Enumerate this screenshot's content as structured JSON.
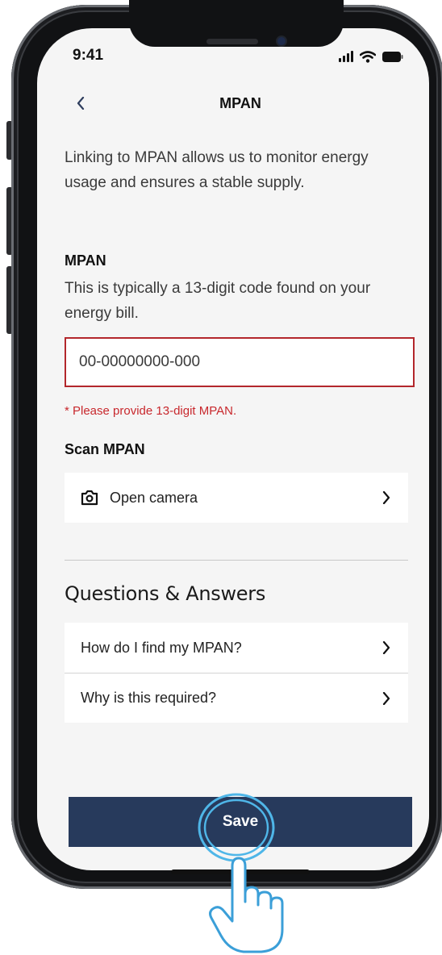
{
  "status_bar": {
    "time": "9:41"
  },
  "header": {
    "title": "MPAN"
  },
  "intro_text": "Linking to MPAN allows us to monitor energy usage and ensures a stable supply.",
  "mpan_field": {
    "label": "MPAN",
    "hint": "This is typically a 13-digit code found on your energy bill.",
    "placeholder": "00-00000000-000",
    "value": "",
    "error": "* Please provide 13-digit MPAN."
  },
  "scan_section": {
    "label": "Scan MPAN",
    "open_camera_label": "Open camera",
    "icon": "camera-icon"
  },
  "qa_section": {
    "title": "Questions & Answers",
    "items": [
      {
        "label": "How do I find my MPAN?"
      },
      {
        "label": "Why is this required?"
      }
    ]
  },
  "save_button": {
    "label": "Save"
  },
  "colors": {
    "primary": "#273a5c",
    "error": "#c8282d",
    "tap_highlight": "#4fb6e8",
    "screen_bg": "#f5f5f5"
  }
}
